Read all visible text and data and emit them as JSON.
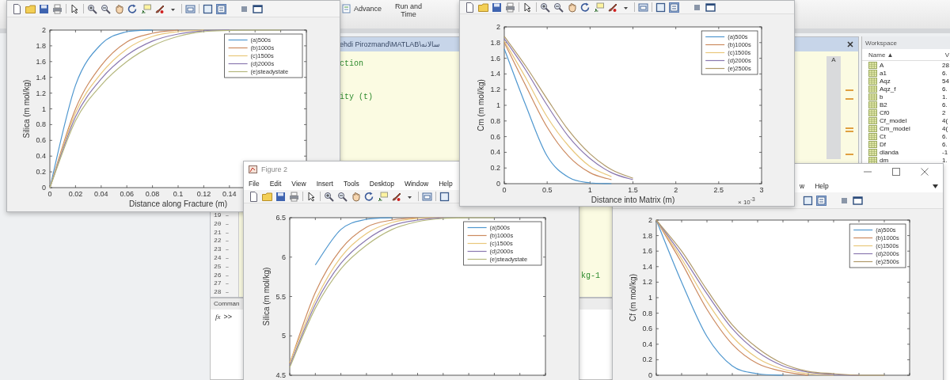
{
  "ribbon": {
    "buttons": [
      "Advance",
      "Run and Time"
    ]
  },
  "editor": {
    "path": "ehdi Pirozmand\\MATLAB\\سالانه",
    "indicator": "A",
    "code": [
      "ction",
      "ity (t)",
      "kg-1"
    ],
    "line_numbers": [
      {
        "number": "19",
        "marker": "–"
      },
      {
        "number": "20",
        "marker": "–"
      },
      {
        "number": "21",
        "marker": "–"
      },
      {
        "number": "22",
        "marker": "–"
      },
      {
        "number": "23",
        "marker": "–"
      },
      {
        "number": "24",
        "marker": "–"
      },
      {
        "number": "25",
        "marker": "–"
      },
      {
        "number": "26",
        "marker": "–"
      },
      {
        "number": "27",
        "marker": "–"
      },
      {
        "number": "28",
        "marker": "–"
      }
    ]
  },
  "command_window": {
    "title": "Comman",
    "function_button": "fx",
    "prompt": ">>"
  },
  "workspace": {
    "title": "Workspace",
    "columns": [
      "Name ▲",
      "V"
    ],
    "rows": [
      {
        "name": "A",
        "value": "28"
      },
      {
        "name": "a1",
        "value": "6."
      },
      {
        "name": "Aqz",
        "value": "54"
      },
      {
        "name": "Aqz_f",
        "value": "6."
      },
      {
        "name": "b",
        "value": "1."
      },
      {
        "name": "B2",
        "value": "6."
      },
      {
        "name": "Cf0",
        "value": "2"
      },
      {
        "name": "Cf_model",
        "value": "4("
      },
      {
        "name": "Cm_model",
        "value": "4("
      },
      {
        "name": "Ct",
        "value": "6."
      },
      {
        "name": "Df",
        "value": "6."
      },
      {
        "name": "dlanda",
        "value": "-1"
      },
      {
        "name": "dm",
        "value": "1."
      }
    ]
  },
  "figures": [
    {
      "chart_data": {
        "type": "line",
        "xlabel": "Distance along Fracture (m)",
        "ylabel": "Silica (m mol/kg)",
        "x": [
          0,
          0.02,
          0.04,
          0.06,
          0.08,
          0.1,
          0.12,
          0.14,
          0.16,
          0.18
        ],
        "xlim": [
          0,
          0.2
        ],
        "ylim": [
          0,
          2
        ],
        "xticks": [
          0,
          0.02,
          0.04,
          0.06,
          0.08,
          0.1,
          0.12,
          0.14
        ],
        "yticks": [
          0,
          0.2,
          0.4,
          0.6,
          0.8,
          1,
          1.2,
          1.4,
          1.6,
          1.8,
          2
        ],
        "legend": true,
        "series": [
          {
            "name": "(a)500s",
            "color": "#4f97cf",
            "values": [
              0,
              1.3,
              1.82,
              1.98,
              2,
              null,
              null,
              null,
              null,
              null
            ]
          },
          {
            "name": "(b)1000s",
            "color": "#cc8a5f",
            "values": [
              0,
              1.0,
              1.55,
              1.85,
              1.96,
              2,
              null,
              null,
              null,
              null
            ]
          },
          {
            "name": "(c)1500s",
            "color": "#e9c77b",
            "values": [
              0,
              0.95,
              1.45,
              1.76,
              1.92,
              1.98,
              2,
              null,
              null,
              null
            ]
          },
          {
            "name": "(d)2000s",
            "color": "#8a78b0",
            "values": [
              0,
              0.9,
              1.38,
              1.68,
              1.86,
              1.95,
              1.99,
              2,
              null,
              null
            ]
          },
          {
            "name": "(e)steadystate",
            "color": "#b5b87e",
            "values": [
              0,
              0.85,
              1.3,
              1.6,
              1.8,
              1.92,
              1.98,
              1.995,
              2,
              2
            ]
          }
        ]
      }
    },
    {
      "chart_data": {
        "type": "line",
        "xlabel": "Distance into Matrix (m)",
        "ylabel": "Cm (m mol/kg)",
        "x": [
          0,
          0.25,
          0.5,
          0.75,
          1,
          1.25,
          1.5
        ],
        "xlim": [
          0,
          3
        ],
        "ylim": [
          0,
          2
        ],
        "xticks": [
          0,
          0.5,
          1,
          1.5,
          2,
          2.5,
          3
        ],
        "yticks": [
          0,
          0.2,
          0.4,
          0.6,
          0.8,
          1,
          1.2,
          1.4,
          1.6,
          1.8,
          2
        ],
        "annotations": [
          {
            "text": "× 10$^{-3}$"
          }
        ],
        "legend": true,
        "series": [
          {
            "name": "(a)500s",
            "color": "#4f97cf",
            "values": [
              1.72,
              1.0,
              0.35,
              0.08,
              0.01,
              0,
              null
            ]
          },
          {
            "name": "(b)1000s",
            "color": "#cc8a5f",
            "values": [
              1.8,
              1.25,
              0.72,
              0.35,
              0.14,
              0.05,
              null
            ]
          },
          {
            "name": "(c)1500s",
            "color": "#e9c77b",
            "values": [
              1.82,
              1.35,
              0.85,
              0.48,
              0.22,
              0.09,
              null
            ]
          },
          {
            "name": "(d)2000s",
            "color": "#8a78b0",
            "values": [
              1.85,
              1.45,
              1.0,
              0.6,
              0.32,
              0.14,
              0.05
            ]
          },
          {
            "name": "(e)2500s",
            "color": "#b09a6a",
            "values": [
              1.88,
              1.5,
              1.08,
              0.68,
              0.38,
              0.18,
              0.07
            ]
          }
        ]
      }
    },
    {
      "title": "Figure 2",
      "menu": [
        "File",
        "Edit",
        "View",
        "Insert",
        "Tools",
        "Desktop",
        "Window",
        "Help"
      ],
      "chart_data": {
        "type": "line",
        "ylabel": "Silica (m mol/kg)",
        "ylim": [
          4.5,
          6.5
        ],
        "yticks": [
          4.5,
          5,
          5.5,
          6,
          6.5
        ],
        "legend": true,
        "series": [
          {
            "name": "(a)500s",
            "color": "#4f97cf",
            "values": [
              null,
              5.9,
              6.35,
              6.48,
              6.5,
              null,
              null,
              null,
              null,
              null,
              null
            ]
          },
          {
            "name": "(b)1000s",
            "color": "#cc8a5f",
            "values": [
              4.65,
              5.55,
              6.1,
              6.38,
              6.47,
              6.5,
              null,
              null,
              null,
              null,
              null
            ]
          },
          {
            "name": "(c)1500s",
            "color": "#e9c77b",
            "values": [
              4.66,
              5.45,
              6.0,
              6.3,
              6.44,
              6.49,
              6.5,
              null,
              null,
              null,
              null
            ]
          },
          {
            "name": "(d)2000s",
            "color": "#8a78b0",
            "values": [
              4.62,
              5.4,
              5.92,
              6.22,
              6.4,
              6.47,
              6.5,
              null,
              null,
              null,
              null
            ]
          },
          {
            "name": "(e)steadystate",
            "color": "#b5b87e",
            "values": [
              4.6,
              5.35,
              5.85,
              6.15,
              6.35,
              6.45,
              6.49,
              6.5,
              6.5,
              null,
              null
            ]
          }
        ]
      }
    },
    {
      "menu": [
        "w",
        "Help"
      ],
      "chart_data": {
        "type": "line",
        "ylabel": "Cf (m mol/kg)",
        "ylim": [
          0,
          2
        ],
        "yticks": [
          0,
          0.2,
          0.4,
          0.6,
          0.8,
          1,
          1.2,
          1.4,
          1.6,
          1.8,
          2
        ],
        "legend": true,
        "series": [
          {
            "name": "(a)500s",
            "color": "#4f97cf",
            "values": [
              2,
              1.2,
              0.5,
              0.12,
              0.02,
              0,
              null,
              null,
              null,
              null,
              null
            ]
          },
          {
            "name": "(b)1000s",
            "color": "#cc8a5f",
            "values": [
              2,
              1.45,
              0.85,
              0.4,
              0.15,
              0.05,
              0,
              null,
              null,
              null,
              null
            ]
          },
          {
            "name": "(c)1500s",
            "color": "#e9c77b",
            "values": [
              2,
              1.5,
              0.95,
              0.5,
              0.22,
              0.08,
              0.02,
              0,
              null,
              null,
              null
            ]
          },
          {
            "name": "(d)2000s",
            "color": "#8a78b0",
            "values": [
              2,
              1.55,
              1.05,
              0.6,
              0.3,
              0.12,
              0.04,
              0.01,
              0,
              null,
              null
            ]
          },
          {
            "name": "(e)2500s",
            "color": "#b09a6a",
            "values": [
              2,
              1.6,
              1.1,
              0.65,
              0.35,
              0.15,
              0.05,
              0.02,
              0,
              0,
              null
            ]
          }
        ]
      }
    }
  ]
}
